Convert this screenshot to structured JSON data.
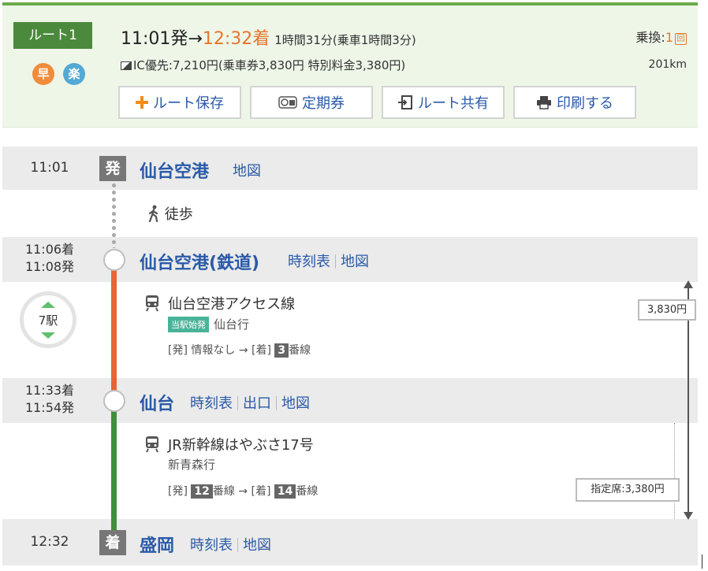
{
  "summary": {
    "route_label": "ルート1",
    "badges": [
      "早",
      "楽"
    ],
    "depart_time": "11:01発",
    "arrow": "→",
    "arrive_time": "12:32着",
    "duration": "1時間31分(乗車1時間3分)",
    "transfer_label": "乗換:",
    "transfer_count": "1",
    "transfer_box": "回",
    "fare_text": "IC優先:7,210円(乗車券3,830円  特別料金3,380円)",
    "distance": "201km",
    "buttons": [
      {
        "label": "ルート保存",
        "icon": "plus-icon"
      },
      {
        "label": "定期券",
        "icon": "pass-icon"
      },
      {
        "label": "ルート共有",
        "icon": "share-icon"
      },
      {
        "label": "印刷する",
        "icon": "printer-icon"
      }
    ]
  },
  "timeline": {
    "stations": [
      {
        "time": "11:01",
        "mark": "発",
        "name": "仙台空港",
        "links": [
          "地図"
        ]
      },
      {
        "arrive": "11:06着",
        "depart": "11:08発",
        "name": "仙台空港(鉄道)",
        "links": [
          "時刻表",
          "地図"
        ]
      },
      {
        "arrive": "11:33着",
        "depart": "11:54発",
        "name": "仙台",
        "links": [
          "時刻表",
          "出口",
          "地図"
        ]
      },
      {
        "time": "12:32",
        "mark": "着",
        "name": "盛岡",
        "links": [
          "時刻表",
          "地図"
        ]
      }
    ],
    "walk_label": "徒歩",
    "segments": [
      {
        "line": "仙台空港アクセス線",
        "start_tag": "当駅始発",
        "destination": "仙台行",
        "platform_prefix": "[発] 情報なし → [着]",
        "arr_platform": "3",
        "platform_suffix": "番線",
        "stops": "7駅",
        "color": "#e8652f"
      },
      {
        "line": "JR新幹線はやぶさ17号",
        "destination": "新青森行",
        "dep_prefix": "[発]",
        "dep_platform": "12",
        "mid": "番線 → [着]",
        "arr_platform": "14",
        "platform_suffix": "番線",
        "color": "#3e8f3a"
      }
    ],
    "fare_ticket": "3,830円",
    "fare_reserved": "指定席:3,380円"
  },
  "colors": {
    "accent_green": "#4b8a3c",
    "link_blue": "#2a5aa8",
    "orange": "#e5762c"
  }
}
